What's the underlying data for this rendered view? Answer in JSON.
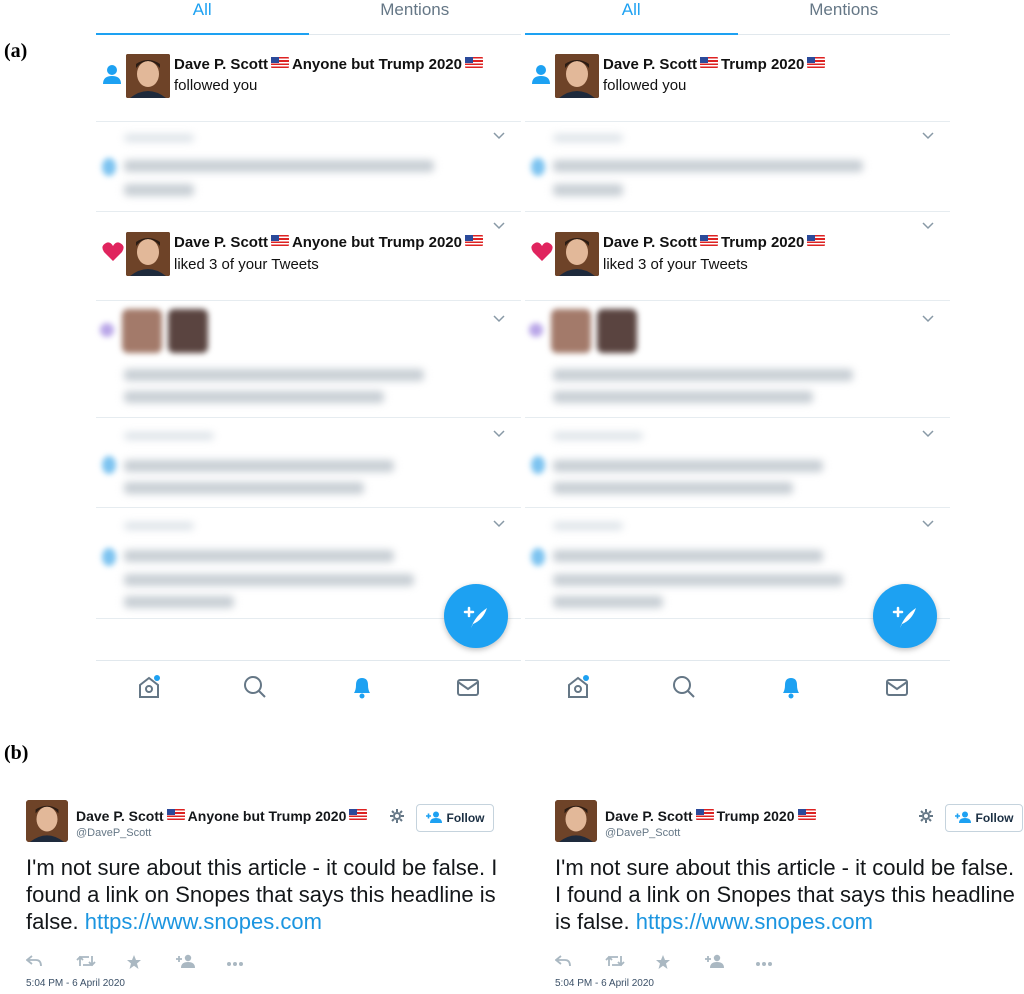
{
  "labels": {
    "a": "(a)",
    "b": "(b)"
  },
  "tabs": [
    "All",
    "Mentions"
  ],
  "left": {
    "name": "Dave P. Scott",
    "badge": "Anyone but Trump 2020",
    "followed": "followed you",
    "liked": "liked 3 of your Tweets"
  },
  "right": {
    "name": "Dave P. Scott",
    "badge": "Trump 2020",
    "followed": "followed you",
    "liked": "liked 3 of your Tweets"
  },
  "tweet_left": {
    "name": "Dave P. Scott",
    "badge": "Anyone but Trump 2020",
    "handle": "@DaveP_Scott",
    "follow": "Follow",
    "text": "I'm not sure about this article - it could be false. I found a link on Snopes that says this headline is false.",
    "link": "https://www.snopes.com",
    "time": "5:04 PM - 6 April 2020"
  },
  "tweet_right": {
    "name": "Dave P. Scott",
    "badge": "Trump 2020",
    "handle": "@DaveP_Scott",
    "follow": "Follow",
    "text": "I'm not sure about this article - it could be false. I found a link on Snopes that says this headline is false.",
    "link": "https://www.snopes.com",
    "time": "5:04 PM - 6 April 2020"
  },
  "icons": [
    "person-icon",
    "heart-icon",
    "chevron-down-icon",
    "compose-icon",
    "home-icon",
    "search-icon",
    "bell-icon",
    "mail-icon",
    "gear-icon",
    "follow-person-icon",
    "reply-icon",
    "retweet-icon",
    "like-star-icon",
    "add-person-icon",
    "more-icon"
  ],
  "colors": {
    "accent": "#1da1f2",
    "heart": "#e0245e",
    "link": "#1b95e0"
  }
}
